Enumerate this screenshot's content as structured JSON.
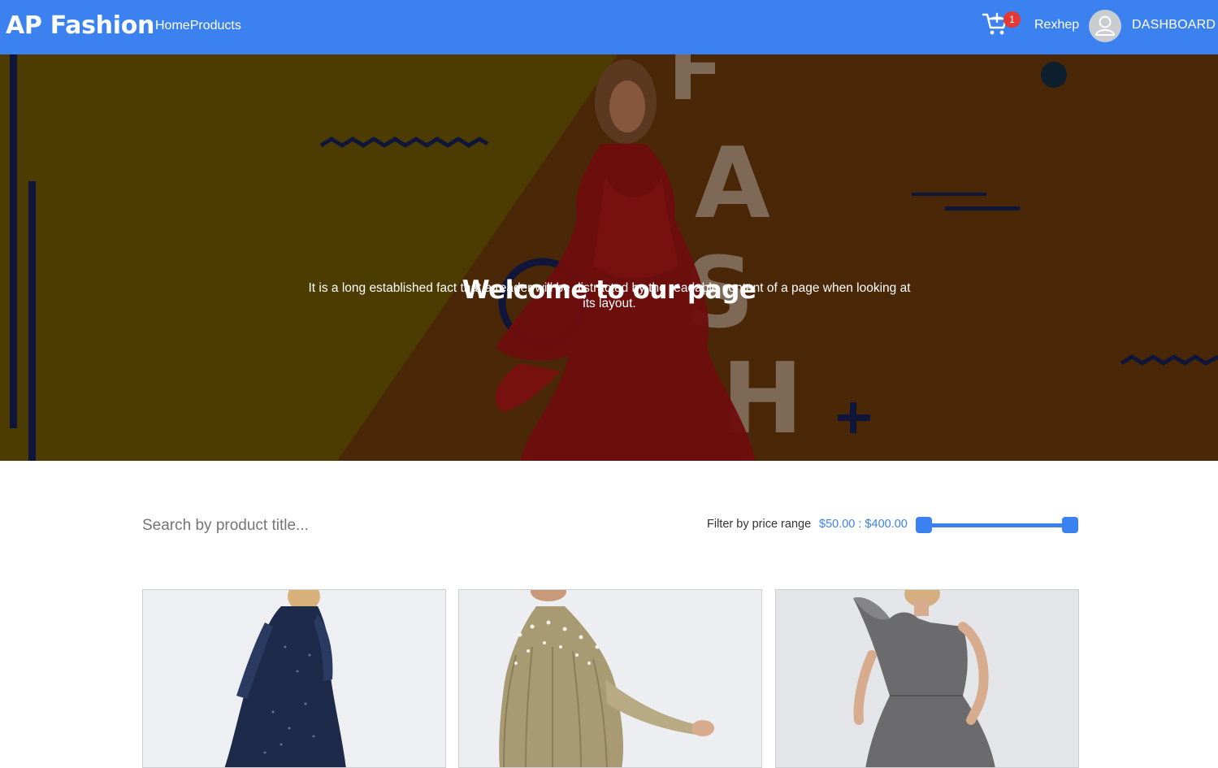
{
  "header": {
    "brand": "AP Fashion",
    "nav": [
      "Home",
      "Products"
    ],
    "cart_count": "1",
    "username": "Rexhep",
    "dashboard_label": "DASHBOARD"
  },
  "hero": {
    "title": "Welcome to our page",
    "text": "It is a long established fact that a reader will be distracted by the readable content of a page when looking at its layout.",
    "decor_letters": [
      "F",
      "A",
      "S",
      "H"
    ]
  },
  "filters": {
    "search_placeholder": "Search by product title...",
    "price_label": "Filter by price range",
    "price_range_text": "$50.00 : $400.00",
    "price_min": 50,
    "price_max": 400
  },
  "products": [
    {
      "name": "navy-sequin-dress",
      "color": "#1e2a4a"
    },
    {
      "name": "gold-cape-gown",
      "color": "#a89a72"
    },
    {
      "name": "silver-metallic-dress",
      "color": "#6b6b6d"
    }
  ],
  "colors": {
    "primary": "#3b82f0",
    "badge": "#e53935"
  }
}
